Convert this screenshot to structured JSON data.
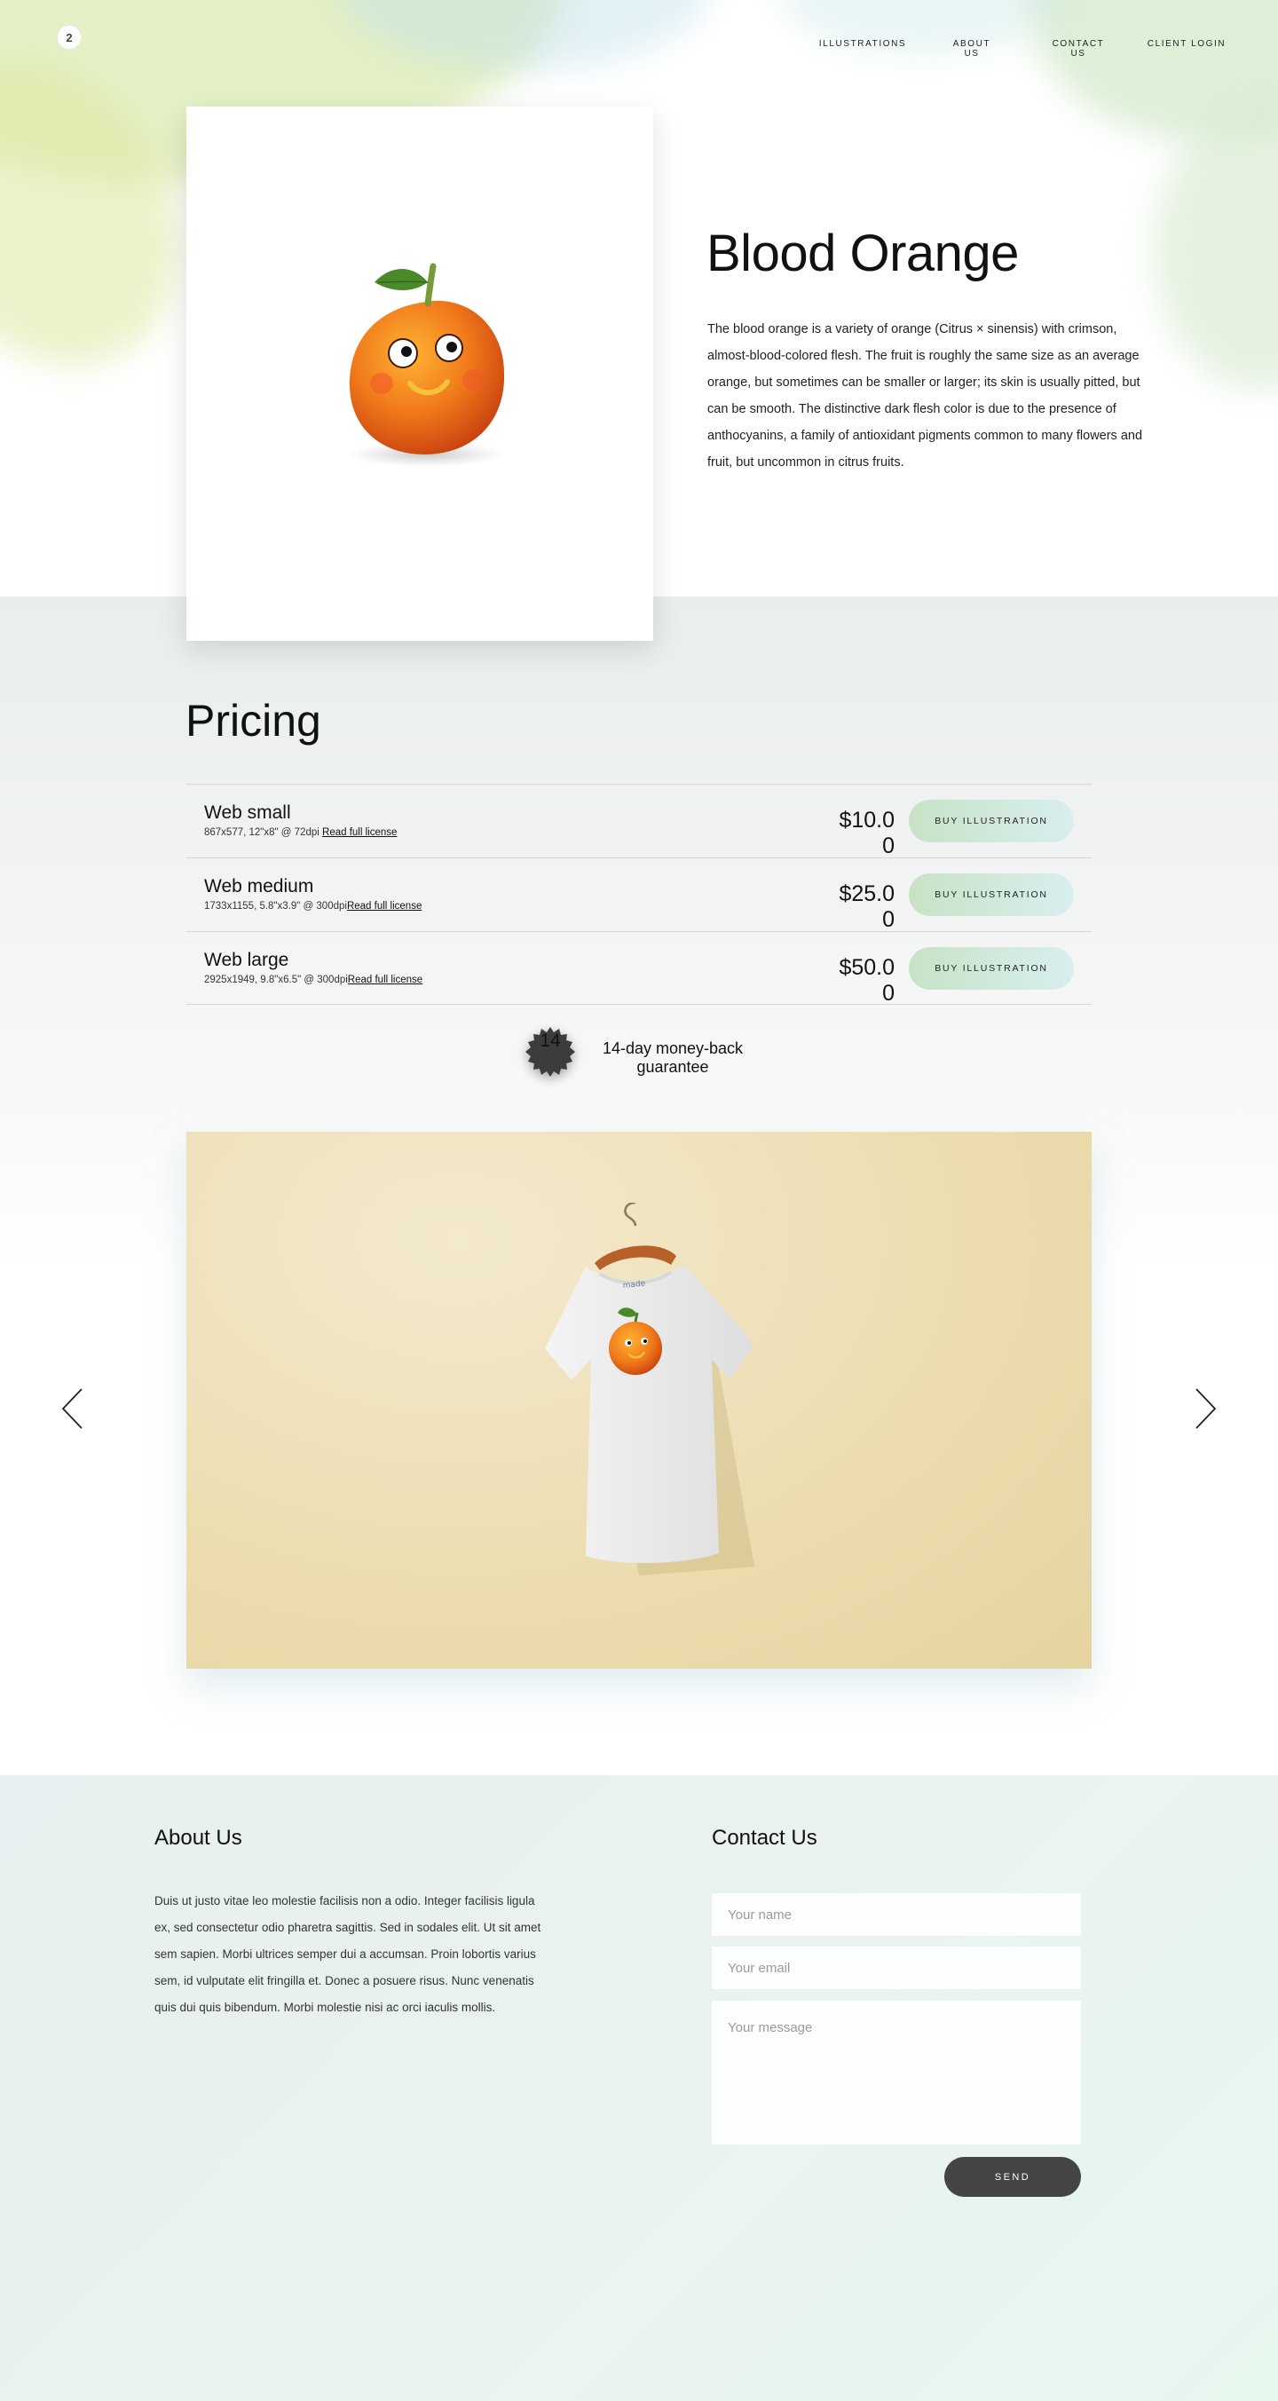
{
  "nav": {
    "logo_text": "2",
    "links": [
      "ILLUSTRATIONS",
      "ABOUT US",
      "CONTACT US",
      "CLIENT LOGIN"
    ]
  },
  "hero": {
    "title": "Blood Orange",
    "description": "The blood orange is a variety of orange (Citrus × sinensis) with crimson, almost-blood-colored flesh. The fruit is roughly the same size as an average orange, but sometimes can be smaller or larger; its skin is usually pitted, but can be smooth. The distinctive dark flesh color is due to the presence of anthocyanins, a family of antioxidant pigments common to many flowers and fruit, but uncommon in citrus fruits."
  },
  "pricing": {
    "title": "Pricing",
    "rows": [
      {
        "name": "Web small",
        "spec": "867x577, 12\"x8\" @ 72dpi",
        "link": "Read full license",
        "price": "$10.00",
        "button": "BUY ILLUSTRATION"
      },
      {
        "name": "Web medium",
        "spec": "1733x1155, 5.8\"x3.9\" @ 300dpi",
        "link": "Read full license",
        "price": "$25.00",
        "button": "BUY ILLUSTRATION"
      },
      {
        "name": "Web large",
        "spec": "2925x1949, 9.8\"x6.5\" @ 300dpi",
        "link": "Read full license",
        "price": "$50.00",
        "button": "BUY ILLUSTRATION"
      }
    ],
    "guarantee_badge": "14",
    "guarantee_text": "14-day money-back guarantee"
  },
  "colors": {
    "button_gradient_start": "#c8e2c6",
    "button_gradient_end": "#d9eeee",
    "send_button": "#454545",
    "slide_background": "#ecdcae"
  },
  "footer": {
    "about_title": "About Us",
    "about_text": "Duis ut justo vitae leo molestie facilisis non a odio. Integer facilisis ligula ex, sed consectetur odio pharetra sagittis. Sed in sodales elit. Ut sit amet sem sapien. Morbi ultrices semper dui a accumsan. Proin lobortis varius sem, id vulputate elit fringilla et. Donec a posuere risus. Nunc venenatis quis dui quis bibendum. Morbi molestie nisi ac orci iaculis mollis.",
    "contact_title": "Contact Us",
    "name_placeholder": "Your name",
    "email_placeholder": "Your email",
    "message_placeholder": "Your message",
    "send_label": "SEND"
  }
}
